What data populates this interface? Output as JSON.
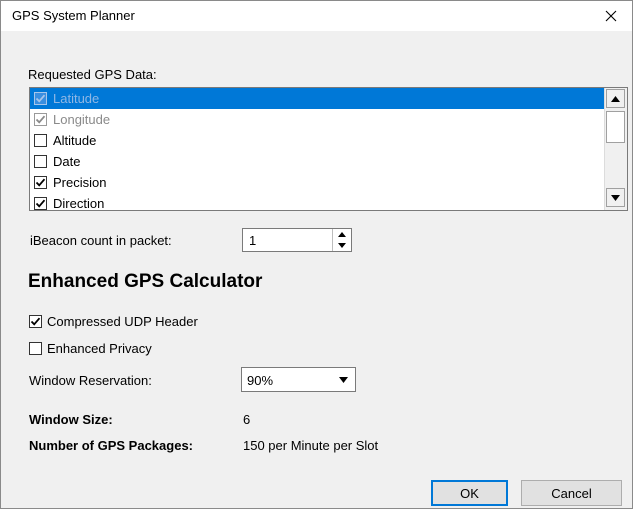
{
  "window": {
    "title": "GPS System Planner"
  },
  "gps_data": {
    "label": "Requested GPS Data:",
    "items": [
      {
        "label": "Latitude",
        "checked": true,
        "disabled": true,
        "selected": true
      },
      {
        "label": "Longitude",
        "checked": true,
        "disabled": true,
        "selected": false
      },
      {
        "label": "Altitude",
        "checked": false,
        "disabled": false,
        "selected": false
      },
      {
        "label": "Date",
        "checked": false,
        "disabled": false,
        "selected": false
      },
      {
        "label": "Precision",
        "checked": true,
        "disabled": false,
        "selected": false
      },
      {
        "label": "Direction",
        "checked": true,
        "disabled": false,
        "selected": false
      }
    ]
  },
  "ibeacon": {
    "label": "iBeacon count in packet:",
    "value": "1"
  },
  "calculator": {
    "heading": "Enhanced GPS Calculator",
    "compressed_udp": {
      "label": "Compressed UDP Header",
      "checked": true
    },
    "enhanced_privacy": {
      "label": "Enhanced Privacy",
      "checked": false
    },
    "window_reservation": {
      "label": "Window Reservation:",
      "value": "90%"
    },
    "window_size": {
      "label": "Window Size:",
      "value": "6"
    },
    "gps_packages": {
      "label": "Number of GPS Packages:",
      "value": "150 per Minute per Slot"
    }
  },
  "buttons": {
    "ok": "OK",
    "cancel": "Cancel"
  },
  "colors": {
    "selection": "#0078d7",
    "background": "#f0f0f0",
    "ok_border": "#0078d7"
  }
}
